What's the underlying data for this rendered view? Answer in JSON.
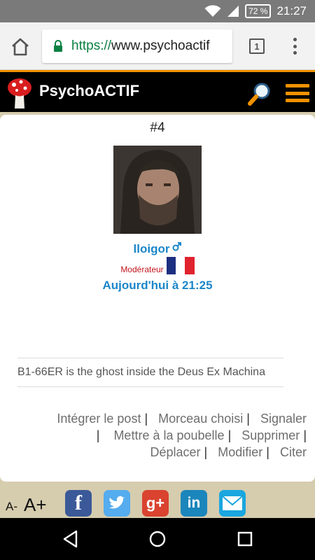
{
  "status_bar": {
    "battery": "72 %",
    "time": "21:27"
  },
  "browser": {
    "url_scheme": "https://",
    "url_host": "www.psychoactif",
    "tab_count": "1"
  },
  "site": {
    "title": "PsychoACTIF"
  },
  "post": {
    "number": "#4",
    "username": "lloigor",
    "role": "Modérateur",
    "date": "Aujourd'hui à  21:25",
    "signature": "B1-66ER is the ghost inside the Deus Ex Machina",
    "actions": [
      "Intégrer le post",
      "Morceau choisi",
      "Signaler",
      "Mettre à la poubelle",
      "Supprimer",
      "Déplacer",
      "Modifier",
      "Citer"
    ],
    "separator": "|"
  },
  "footer": {
    "font_decrease": "A-",
    "font_increase": "A+",
    "share_labels": [
      "f",
      "g+",
      "in"
    ]
  },
  "colors": {
    "accent_orange": "#f29100",
    "link_blue": "#1b86c9",
    "moderator_red": "#c0141b",
    "facebook": "#3b5998",
    "twitter": "#55acee",
    "google_plus": "#d9432f",
    "linkedin": "#1b86bc",
    "email": "#1aa6df"
  }
}
